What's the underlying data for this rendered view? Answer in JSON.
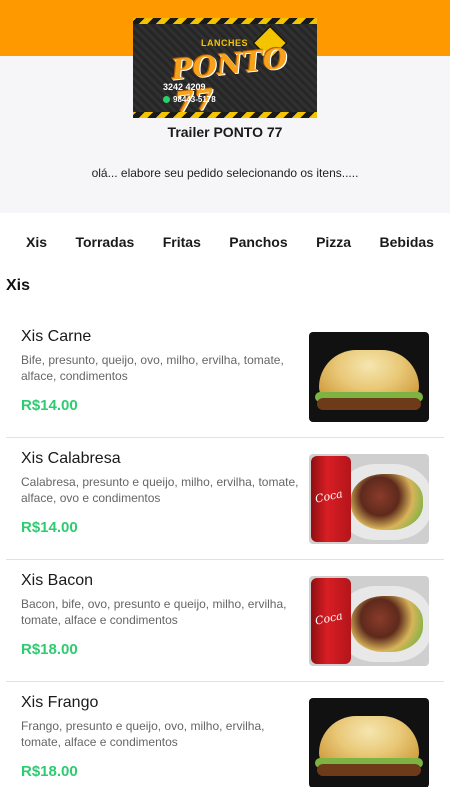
{
  "store": {
    "logo": {
      "title_top": "LANCHES",
      "brand": "PONTO 77",
      "phone": "3242 4209",
      "whatsapp": "98443-5178"
    },
    "name": "Trailer PONTO 77",
    "message": "olá... elabore seu pedido selecionando os itens....."
  },
  "categories": [
    "Xis",
    "Torradas",
    "Fritas",
    "Panchos",
    "Pizza",
    "Bebidas"
  ],
  "section": {
    "title": "Xis",
    "items": [
      {
        "name": "Xis Carne",
        "description": "Bife, presunto, queijo, ovo, milho, ervilha, tomate, alface, condimentos",
        "price": "R$14.00",
        "photo": "burger"
      },
      {
        "name": "Xis Calabresa",
        "description": "Calabresa, presunto e queijo, milho, ervilha, tomate, alface, ovo e condimentos",
        "price": "R$14.00",
        "photo": "combo"
      },
      {
        "name": "Xis Bacon",
        "description": "Bacon, bife, ovo, presunto e queijo, milho, ervilha, tomate, alface e condimentos",
        "price": "R$18.00",
        "photo": "combo"
      },
      {
        "name": "Xis Frango",
        "description": "Frango, presunto e queijo, ovo, milho, ervilha, tomate, alface e condimentos",
        "price": "R$18.00",
        "photo": "burger"
      }
    ]
  },
  "colors": {
    "brand_orange": "#FF9900",
    "price_green": "#2ECC71",
    "header_bg": "#F6F6F9"
  }
}
